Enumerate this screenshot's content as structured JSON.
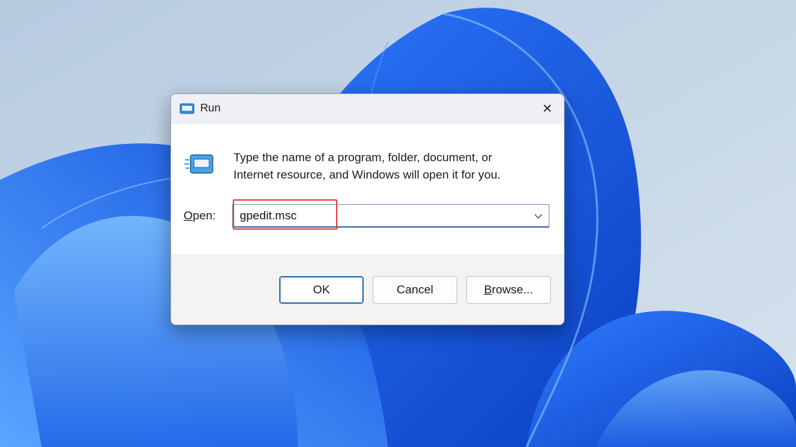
{
  "window": {
    "title": "Run",
    "close_glyph": "✕"
  },
  "dialog": {
    "description_line1": "Type the name of a program, folder, document, or",
    "description_line2": "Internet resource, and Windows will open it for you.",
    "open_label_access": "O",
    "open_label_rest": "pen:",
    "open_value": "gpedit.msc"
  },
  "buttons": {
    "ok": "OK",
    "cancel": "Cancel",
    "browse_access": "B",
    "browse_rest": "rowse..."
  },
  "icons": {
    "title": "run-icon",
    "body": "run-icon",
    "close": "close-icon",
    "dropdown": "chevron-down-icon"
  },
  "colors": {
    "accent": "#2f6fb3",
    "highlight": "#e04848",
    "wallpaper_blue": "#1a5ee8"
  }
}
